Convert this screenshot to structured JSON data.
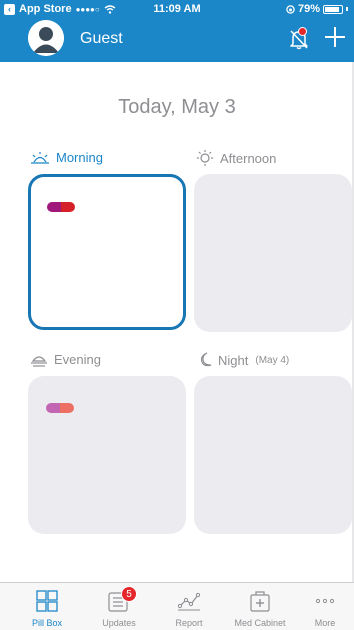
{
  "status_bar": {
    "back_app": "App Store",
    "signal": "●●●●○",
    "time": "11:09 AM",
    "battery": "79%"
  },
  "header": {
    "user_name": "Guest",
    "icons": [
      "avatar",
      "bell-muted-icon",
      "plus-icon"
    ],
    "bell_has_alert": true
  },
  "main": {
    "date_title": "Today, May 3",
    "slots": [
      {
        "label": "Morning",
        "sub": "",
        "icon": "sunrise-icon",
        "active": true,
        "pills": [
          {
            "colors": [
              "#a0187c",
              "#d5202a"
            ]
          }
        ]
      },
      {
        "label": "Afternoon",
        "sub": "",
        "icon": "sun-icon",
        "active": false,
        "pills": []
      },
      {
        "label": "Evening",
        "sub": "",
        "icon": "sunset-icon",
        "active": false,
        "pills": [
          {
            "colors": [
              "#c266b4",
              "#ed6f64"
            ]
          }
        ]
      },
      {
        "label": "Night",
        "sub": "(May 4)",
        "icon": "moon-icon",
        "active": false,
        "pills": []
      }
    ]
  },
  "tabbar": {
    "tabs": [
      {
        "label": "Pill Box",
        "icon": "grid-icon",
        "active": true
      },
      {
        "label": "Updates",
        "icon": "list-icon",
        "active": false,
        "badge": "5"
      },
      {
        "label": "Report",
        "icon": "chart-line-icon",
        "active": false
      },
      {
        "label": "Med Cabinet",
        "icon": "medkit-icon",
        "active": false
      },
      {
        "label": "More",
        "icon": "more-icon",
        "active": false
      }
    ]
  },
  "colors": {
    "header": "#1b86c8",
    "accent": "#1b86c8",
    "selected_border": "#1876b4",
    "slot_bg": "#ebebf0",
    "badge": "#e5262b"
  }
}
